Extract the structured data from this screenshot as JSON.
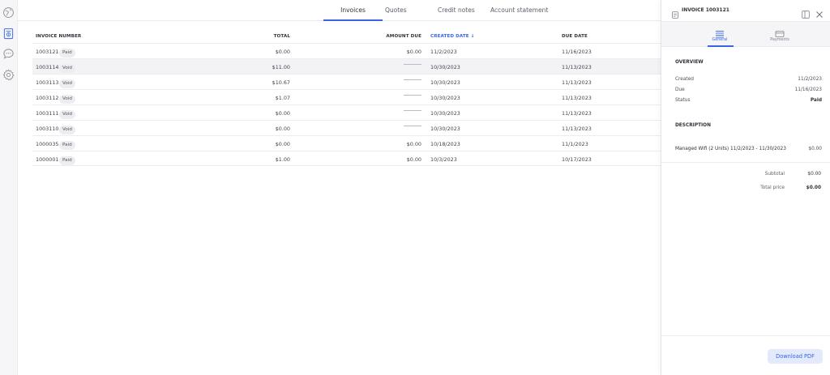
{
  "tabs": [
    {
      "label": "Invoices",
      "active": true
    },
    {
      "label": "Quotes",
      "active": false
    },
    {
      "label": "Credit notes",
      "active": false
    },
    {
      "label": "Account statement",
      "active": false
    }
  ],
  "rail": [
    "globe-icon",
    "invoice-icon",
    "chat-icon",
    "settings-icon"
  ],
  "table": {
    "headers": {
      "invoice_number": "INVOICE NUMBER",
      "total": "TOTAL",
      "amount_due": "AMOUNT DUE",
      "created_date": "CREATED DATE ↓",
      "due_date": "DUE DATE"
    },
    "rows": [
      {
        "number": "1003121",
        "status": "Paid",
        "total": "$0.00",
        "amount_due": "$0.00",
        "created": "11/2/2023",
        "due": "11/16/2023"
      },
      {
        "number": "1003114",
        "status": "Void",
        "total": "$11.00",
        "amount_due": "",
        "created": "10/30/2023",
        "due": "11/13/2023"
      },
      {
        "number": "1003113",
        "status": "Void",
        "total": "$10.67",
        "amount_due": "",
        "created": "10/30/2023",
        "due": "11/13/2023"
      },
      {
        "number": "1003112",
        "status": "Void",
        "total": "$1.07",
        "amount_due": "",
        "created": "10/30/2023",
        "due": "11/13/2023"
      },
      {
        "number": "1003111",
        "status": "Void",
        "total": "$0.00",
        "amount_due": "",
        "created": "10/30/2023",
        "due": "11/13/2023"
      },
      {
        "number": "1003110",
        "status": "Void",
        "total": "$0.00",
        "amount_due": "",
        "created": "10/30/2023",
        "due": "11/13/2023"
      },
      {
        "number": "1000035",
        "status": "Paid",
        "total": "$0.00",
        "amount_due": "$0.00",
        "created": "10/18/2023",
        "due": "11/1/2023"
      },
      {
        "number": "1000001",
        "status": "Paid",
        "total": "$1.00",
        "amount_due": "$0.00",
        "created": "10/3/2023",
        "due": "10/17/2023"
      }
    ]
  },
  "panel": {
    "title": "INVOICE 1003121",
    "tabs": [
      {
        "label": "General",
        "active": true
      },
      {
        "label": "Payments",
        "active": false
      }
    ],
    "overview_heading": "OVERVIEW",
    "overview": [
      {
        "key": "Created",
        "value": "11/2/2023"
      },
      {
        "key": "Due",
        "value": "11/16/2023"
      },
      {
        "key": "Status",
        "value": "Paid"
      }
    ],
    "description_heading": "DESCRIPTION",
    "line_item": {
      "label": "Managed Wifi (2 Units) 11/2/2023 - 11/30/2023",
      "amount": "$0.00"
    },
    "subtotal": {
      "label": "Subtotal",
      "value": "$0.00"
    },
    "total_price": {
      "label": "Total price",
      "value": "$0.00"
    },
    "download_label": "Download PDF"
  },
  "colors": {
    "accent": "#3c66e0",
    "badge_bg": "#ecedf1",
    "row_highlight": "#f3f3f6"
  }
}
